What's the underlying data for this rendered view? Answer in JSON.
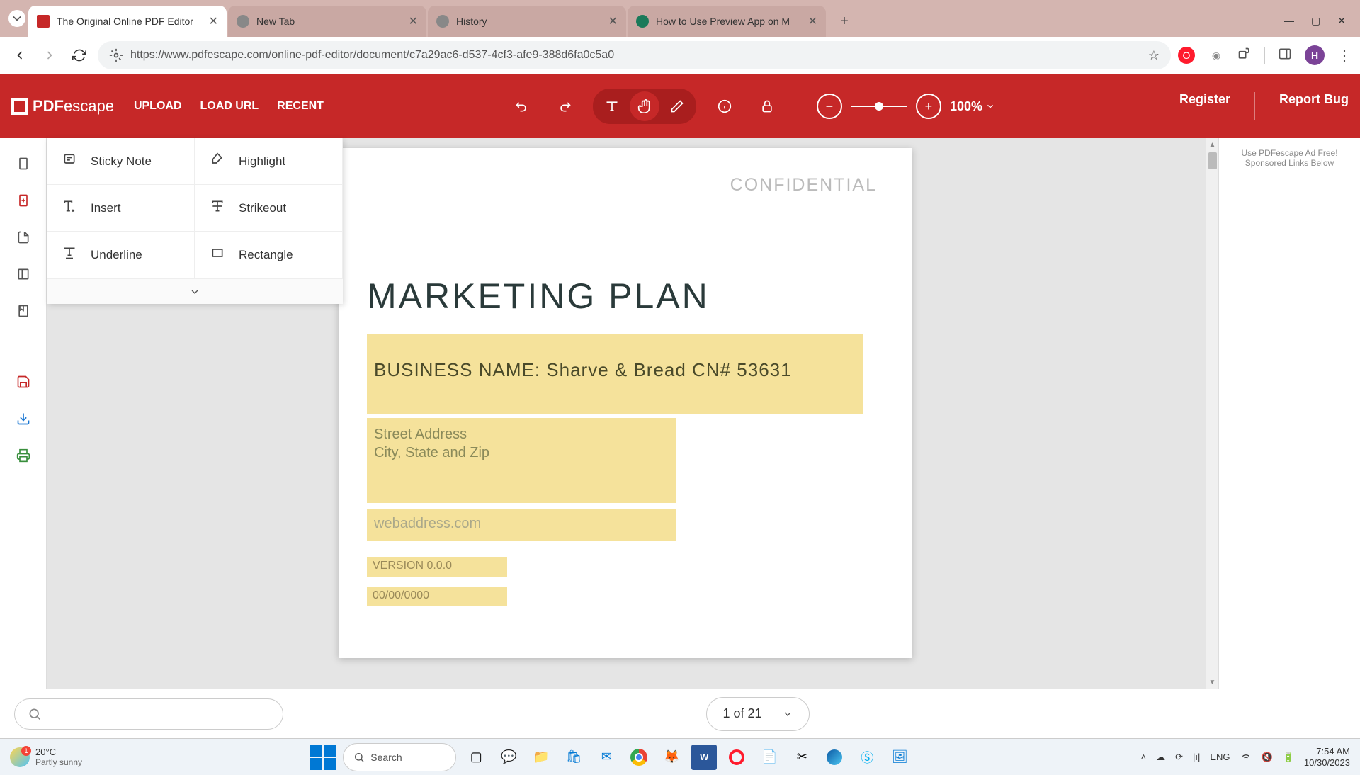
{
  "browser": {
    "tabs": [
      {
        "title": "The Original Online PDF Editor",
        "active": true
      },
      {
        "title": "New Tab",
        "active": false
      },
      {
        "title": "History",
        "active": false
      },
      {
        "title": "How to Use Preview App on M",
        "active": false
      }
    ],
    "url": "https://www.pdfescape.com/online-pdf-editor/document/c7a29ac6-d537-4cf3-afe9-388d6fa0c5a0",
    "profile_initial": "H"
  },
  "app": {
    "logo": "PDFescape",
    "nav": {
      "upload": "UPLOAD",
      "load_url": "LOAD URL",
      "recent": "RECENT"
    },
    "zoom": "100%",
    "register": "Register",
    "report_bug": "Report Bug"
  },
  "tools": {
    "sticky_note": "Sticky Note",
    "highlight": "Highlight",
    "insert": "Insert",
    "strikeout": "Strikeout",
    "underline": "Underline",
    "rectangle": "Rectangle"
  },
  "document": {
    "watermark": "CONFIDENTIAL",
    "title": "MARKETING PLAN",
    "business_name": "BUSINESS NAME: Sharve & Bread CN# 53631",
    "address_line1": "Street Address",
    "address_line2": "City, State and Zip",
    "web": "webaddress.com",
    "version": "VERSION 0.0.0",
    "date": "00/00/0000"
  },
  "ad": {
    "line1": "Use PDFescape Ad Free!",
    "line2": "Sponsored Links Below"
  },
  "bottom": {
    "page_indicator": "1 of 21"
  },
  "taskbar": {
    "temp": "20°C",
    "weather": "Partly sunny",
    "weather_badge": "1",
    "search": "Search",
    "lang": "ENG",
    "time": "7:54 AM",
    "date": "10/30/2023"
  }
}
